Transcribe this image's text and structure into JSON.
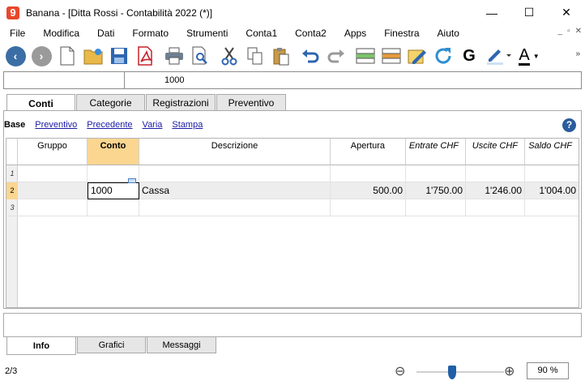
{
  "window": {
    "app_logo": "9",
    "title": "Banana - [Ditta Rossi - Contabilità 2022 (*)]",
    "minimize": "—",
    "maximize": "☐",
    "close": "✕"
  },
  "menu": {
    "items": [
      "File",
      "Modifica",
      "Dati",
      "Formato",
      "Strumenti",
      "Conta1",
      "Conta2",
      "Apps",
      "Finestra",
      "Aiuto"
    ],
    "mdi": {
      "minimize": "_",
      "restore": "▫",
      "close": "✕"
    }
  },
  "toolbar": {
    "icons": [
      "back-icon",
      "forward-icon",
      "new-file-icon",
      "open-file-icon",
      "save-icon",
      "pdf-icon",
      "print-icon",
      "print-preview-icon",
      "cut-icon",
      "copy-icon",
      "paste-icon",
      "undo-icon",
      "redo-icon",
      "add-row-icon",
      "delete-row-icon",
      "edit-icon",
      "recalculate-icon",
      "bold-icon",
      "highlight-icon",
      "font-color-icon"
    ],
    "bold_glyph": "G",
    "font_color_glyph": "A",
    "more_glyph": "»"
  },
  "cell_bar": {
    "reference": "",
    "value": "1000"
  },
  "table_tabs": [
    "Conti",
    "Categorie",
    "Registrazioni",
    "Preventivo"
  ],
  "views": {
    "items": [
      "Base",
      "Preventivo",
      "Precedente",
      "Varia",
      "Stampa"
    ],
    "help_glyph": "?"
  },
  "table": {
    "columns": [
      "Gruppo",
      "Conto",
      "Descrizione",
      "Apertura",
      "Entrate CHF",
      "Uscite CHF",
      "Saldo CHF"
    ],
    "rows": [
      {
        "num": "1",
        "gruppo": "",
        "conto": "",
        "descrizione": "",
        "apertura": "",
        "entrate": "",
        "uscite": "",
        "saldo": ""
      },
      {
        "num": "2",
        "gruppo": "",
        "conto": "1000",
        "descrizione": "Cassa",
        "apertura": "500.00",
        "entrate": "1'750.00",
        "uscite": "1'246.00",
        "saldo": "1'004.00"
      },
      {
        "num": "3",
        "gruppo": "",
        "conto": "",
        "descrizione": "",
        "apertura": "",
        "entrate": "",
        "uscite": "",
        "saldo": ""
      }
    ]
  },
  "bottom_tabs": [
    "Info",
    "Grafici",
    "Messaggi"
  ],
  "status": {
    "position": "2/3",
    "zoom_value": "90 %",
    "zoom_fraction": 0.36
  },
  "colors": {
    "selected_column": "#fad690",
    "accent_blue": "#1f5fa8",
    "link": "#1a1aa6"
  }
}
